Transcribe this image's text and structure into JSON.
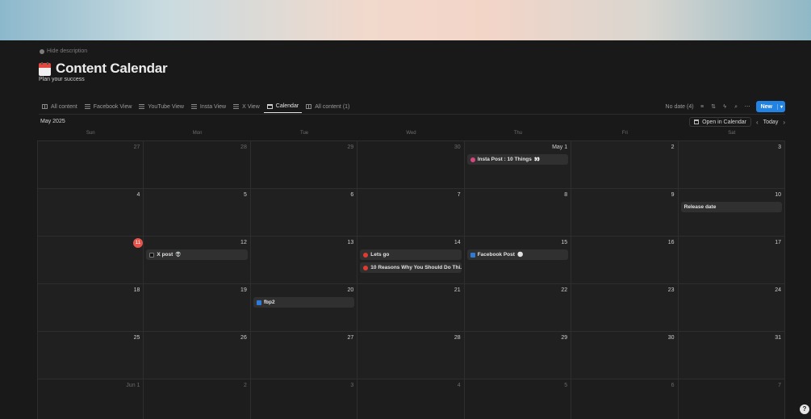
{
  "page": {
    "hide_description": "Hide description",
    "title": "Content Calendar",
    "subtitle": "Plan your success"
  },
  "tabs": [
    {
      "label": "All content",
      "icon": "table-icon",
      "active": false
    },
    {
      "label": "Facebook View",
      "icon": "list-icon",
      "active": false
    },
    {
      "label": "YouTube View",
      "icon": "list-icon",
      "active": false
    },
    {
      "label": "Insta View",
      "icon": "list-icon",
      "active": false
    },
    {
      "label": "X View",
      "icon": "list-icon",
      "active": false
    },
    {
      "label": "Calendar",
      "icon": "calendar-icon",
      "active": true
    },
    {
      "label": "All content (1)",
      "icon": "table-icon",
      "active": false
    }
  ],
  "toolbar": {
    "no_date": "No date (4)",
    "new_label": "New"
  },
  "calendar": {
    "month": "May 2025",
    "open_in_calendar": "Open in Calendar",
    "today_label": "Today",
    "weekdays": [
      "Sun",
      "Mon",
      "Tue",
      "Wed",
      "Thu",
      "Fri",
      "Sat"
    ],
    "weeks": [
      [
        {
          "label": "27",
          "dim": true
        },
        {
          "label": "28",
          "dim": true
        },
        {
          "label": "29",
          "dim": true
        },
        {
          "label": "30",
          "dim": true
        },
        {
          "label": "May 1",
          "dim": false,
          "events": [
            {
              "title": "Insta Post : 10 Things",
              "emoji": "👀",
              "icon_color": "#d9457f",
              "icon": "instagram-icon"
            }
          ]
        },
        {
          "label": "2",
          "dim": false
        },
        {
          "label": "3",
          "dim": false
        }
      ],
      [
        {
          "label": "4"
        },
        {
          "label": "5"
        },
        {
          "label": "6"
        },
        {
          "label": "7"
        },
        {
          "label": "8"
        },
        {
          "label": "9"
        },
        {
          "label": "10",
          "events": [
            {
              "title": "Release date",
              "emoji": "",
              "icon_color": "",
              "icon": ""
            }
          ]
        }
      ],
      [
        {
          "label": "11",
          "today": true
        },
        {
          "label": "12",
          "events": [
            {
              "title": "X post",
              "emoji": "👽",
              "icon_color": "#111111",
              "icon": "x-icon"
            }
          ]
        },
        {
          "label": "13"
        },
        {
          "label": "14",
          "events": [
            {
              "title": "Lets go",
              "emoji": "",
              "icon_color": "#e23b2e",
              "icon": "youtube-icon"
            },
            {
              "title": "10 Reasons Why You Should Do Thi...",
              "emoji": "",
              "icon_color": "#e23b2e",
              "icon": "youtube-icon"
            }
          ]
        },
        {
          "label": "15",
          "events": [
            {
              "title": "Facebook Post",
              "emoji": "⚪",
              "icon_color": "#2d7ad9",
              "icon": "facebook-icon"
            }
          ]
        },
        {
          "label": "16"
        },
        {
          "label": "17"
        }
      ],
      [
        {
          "label": "18"
        },
        {
          "label": "19"
        },
        {
          "label": "20",
          "events": [
            {
              "title": "fbp2",
              "emoji": "",
              "icon_color": "#2d7ad9",
              "icon": "facebook-icon"
            }
          ]
        },
        {
          "label": "21"
        },
        {
          "label": "22"
        },
        {
          "label": "23"
        },
        {
          "label": "24"
        }
      ],
      [
        {
          "label": "25"
        },
        {
          "label": "26"
        },
        {
          "label": "27"
        },
        {
          "label": "28"
        },
        {
          "label": "29"
        },
        {
          "label": "30"
        },
        {
          "label": "31"
        }
      ],
      [
        {
          "label": "Jun 1",
          "dim": true
        },
        {
          "label": "2",
          "dim": true
        },
        {
          "label": "3",
          "dim": true
        },
        {
          "label": "4",
          "dim": true
        },
        {
          "label": "5",
          "dim": true
        },
        {
          "label": "6",
          "dim": true
        },
        {
          "label": "7",
          "dim": true
        }
      ]
    ]
  },
  "help": {
    "label": "?"
  }
}
